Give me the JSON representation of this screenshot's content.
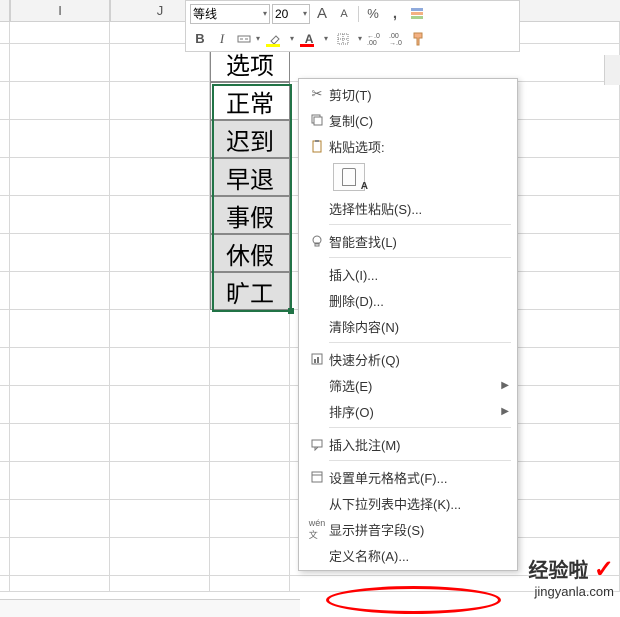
{
  "toolbar": {
    "font_name": "等线",
    "font_size": "20",
    "bold": "B",
    "italic": "I",
    "grow_font": "A",
    "shrink_font": "A",
    "percent": "%",
    "comma": ",",
    "font_color_letter": "A",
    "increase_decimal": "⁺.0\n.00",
    "decrease_decimal": ".00\n→.0"
  },
  "columns": {
    "I": "I",
    "J": "J"
  },
  "cells": {
    "header": "选项",
    "r1": "正常",
    "r2": "迟到",
    "r3": "早退",
    "r4": "事假",
    "r5": "休假",
    "r6": "旷工"
  },
  "menu": {
    "cut": "剪切(T)",
    "copy": "复制(C)",
    "paste_options_label": "粘贴选项:",
    "paste_special": "选择性粘贴(S)...",
    "smart_lookup": "智能查找(L)",
    "insert": "插入(I)...",
    "delete": "删除(D)...",
    "clear": "清除内容(N)",
    "quick_analysis": "快速分析(Q)",
    "filter": "筛选(E)",
    "sort": "排序(O)",
    "insert_comment": "插入批注(M)",
    "format_cells": "设置单元格格式(F)...",
    "pick_from_list": "从下拉列表中选择(K)...",
    "show_phonetic": "显示拼音字段(S)",
    "define_name": "定义名称(A)..."
  },
  "watermark": {
    "main": "经验啦",
    "check": "✓",
    "sub": "jingyanla.com"
  }
}
